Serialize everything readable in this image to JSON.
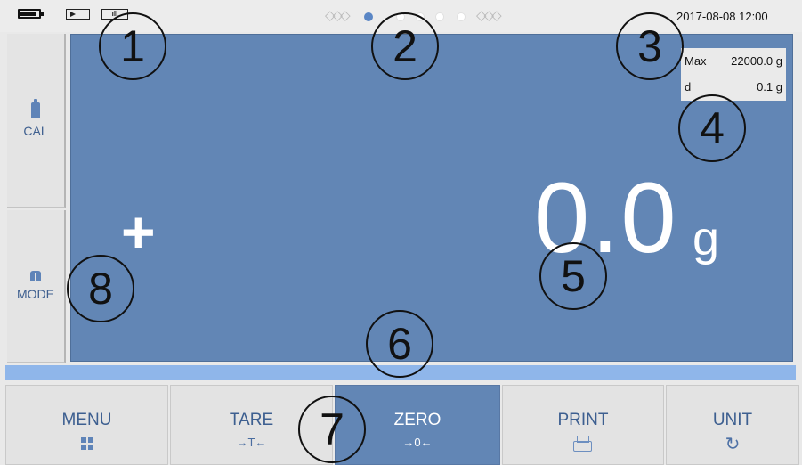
{
  "status_bar": {
    "signal_text": "ıll",
    "pager": {
      "left_arrows": "◇◇◇",
      "right_arrows": "◇◇◇",
      "dot_count": 5,
      "active_index": 0
    },
    "datetime": "2017-08-08 12:00"
  },
  "side_buttons": [
    {
      "label": "CAL",
      "icon": "weight-icon"
    },
    {
      "label": "MODE",
      "icon": "mode-icon"
    }
  ],
  "display": {
    "spec": {
      "max_label": "Max",
      "max_value": "22000.0 g",
      "d_label": "d",
      "d_value": "0.1 g"
    },
    "sign": "+",
    "weight": "0.0",
    "unit": "g"
  },
  "function_bar": [
    {
      "label": "MENU",
      "sub": "",
      "icon": "grid-icon",
      "active": false
    },
    {
      "label": "TARE",
      "sub": "→T←",
      "icon": "",
      "active": false
    },
    {
      "label": "ZERO",
      "sub": "→0←",
      "icon": "",
      "active": true
    },
    {
      "label": "PRINT",
      "sub": "",
      "icon": "printer-icon",
      "active": false
    },
    {
      "label": "UNIT",
      "sub": "",
      "icon": "undo-icon",
      "active": false
    }
  ],
  "callouts": [
    "1",
    "2",
    "3",
    "4",
    "5",
    "6",
    "7",
    "8"
  ],
  "colors": {
    "display_bg": "#6286b5",
    "accent": "#5a86c5",
    "progress": "#8fb6ea",
    "label_blue": "#3d5f90",
    "panel_gray": "#e3e3e3"
  }
}
